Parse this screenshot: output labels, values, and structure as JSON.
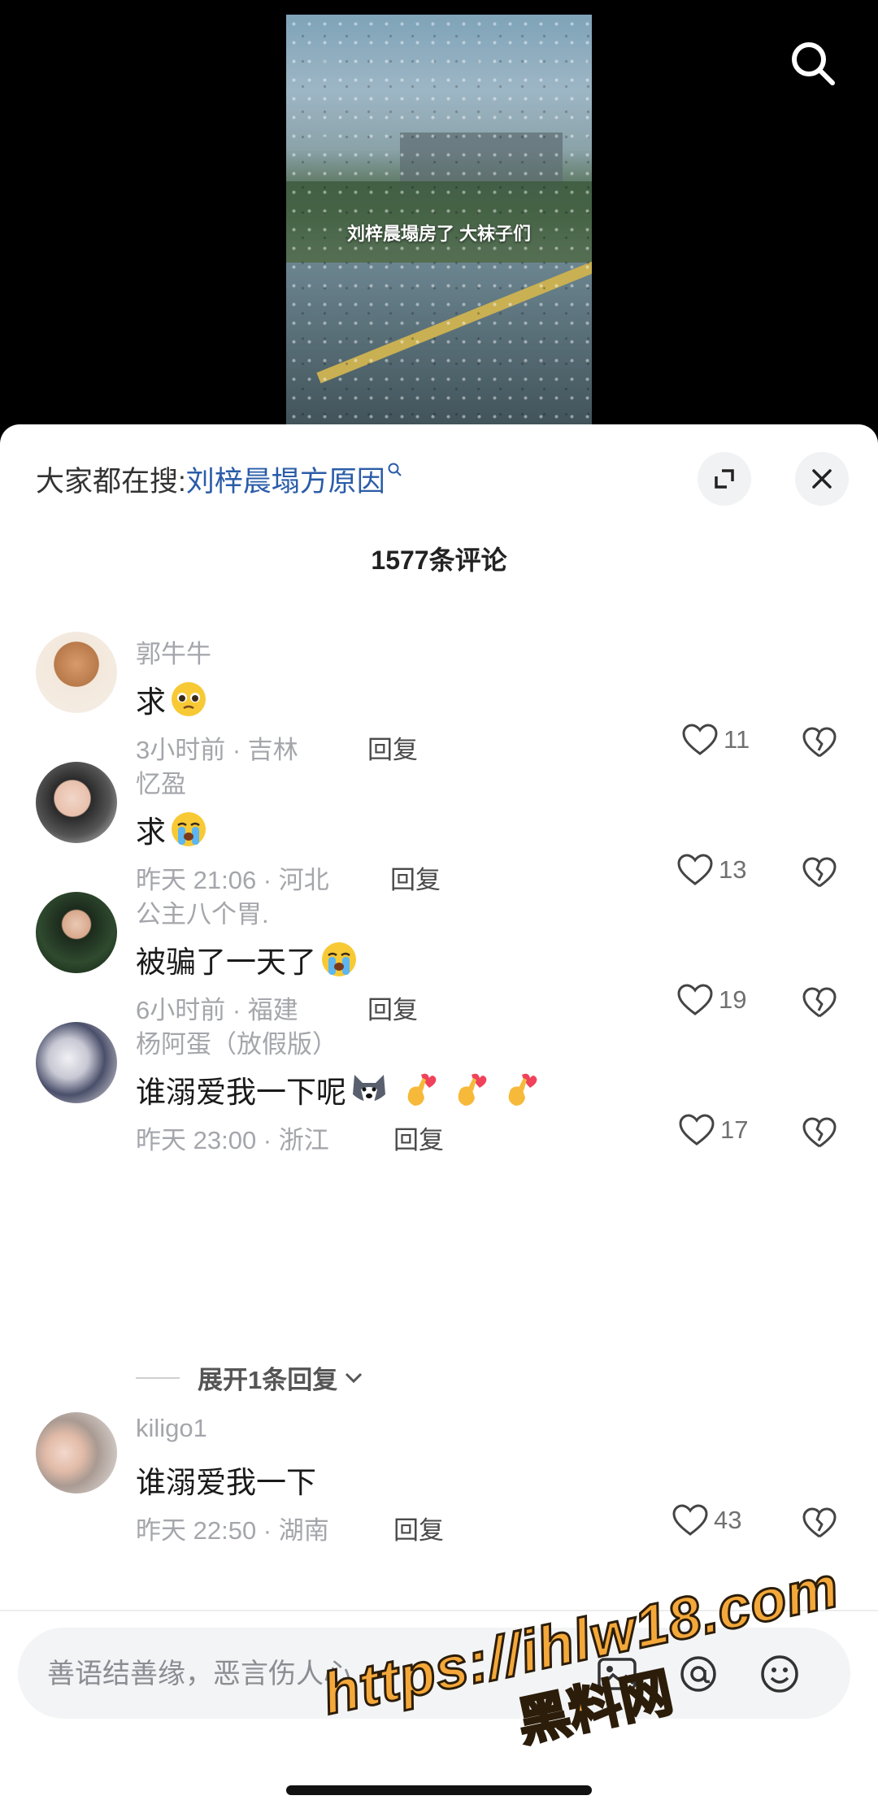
{
  "video": {
    "caption": "刘梓晨塌房了 大袜子们"
  },
  "header": {
    "hot_prefix": "大家都在搜:",
    "hot_link": "刘梓晨塌方原因",
    "comment_count": "1577条评论"
  },
  "comments": [
    {
      "user": "郭牛牛",
      "text": "求",
      "emojis": [
        "pleading-face-emoji"
      ],
      "time": "3小时前 · 吉林",
      "reply": "回复",
      "likes": "11"
    },
    {
      "user": "忆盈",
      "text": "求",
      "emojis": [
        "crying-face-emoji"
      ],
      "time": "昨天 21:06 · 河北",
      "reply": "回复",
      "likes": "13"
    },
    {
      "user": "公主八个胃.",
      "text": "被骗了一天了",
      "emojis": [
        "crying-face-emoji"
      ],
      "time": "6小时前 · 福建",
      "reply": "回复",
      "likes": "19"
    },
    {
      "user": "杨阿蛋（放假版）",
      "text": "谁溺爱我一下呢",
      "emojis": [
        "husky-emoji",
        "finger-heart-emoji",
        "finger-heart-emoji",
        "finger-heart-emoji"
      ],
      "time": "昨天 23:00 · 浙江",
      "reply": "回复",
      "likes": "17"
    },
    {
      "user": "kiligo1",
      "text": "谁溺爱我一下",
      "emojis": [],
      "time": "昨天 22:50 · 湖南",
      "reply": "回复",
      "likes": "43"
    }
  ],
  "expand_replies": "展开1条回复",
  "input": {
    "placeholder": "善语结善缘，恶言伤人心"
  },
  "watermark": {
    "url": "https://ihlw18.com",
    "site": "黑料网"
  },
  "colors": {
    "link": "#2a5ca8",
    "muted": "#a4a6ab",
    "watermark": "#f4a83a"
  }
}
